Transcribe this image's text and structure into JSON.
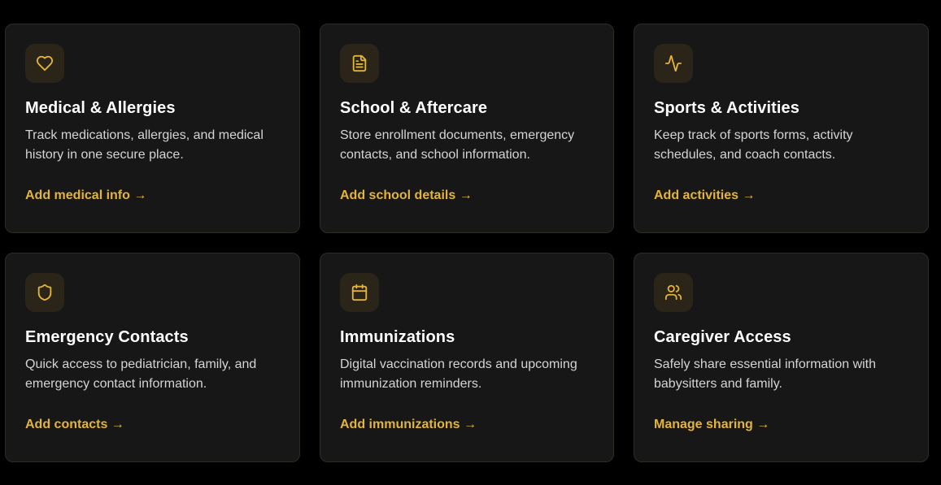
{
  "accent_color": "#e3b43a",
  "cards": [
    {
      "icon": "heart-icon",
      "title": "Medical & Allergies",
      "description": "Track medications, allergies, and medical history in one secure place.",
      "link": "Add medical info →"
    },
    {
      "icon": "document-icon",
      "title": "School & Aftercare",
      "description": "Store enrollment documents, emergency contacts, and school information.",
      "link": "Add school details →"
    },
    {
      "icon": "activity-icon",
      "title": "Sports & Activities",
      "description": "Keep track of sports forms, activity schedules, and coach contacts.",
      "link": "Add activities →"
    },
    {
      "icon": "shield-icon",
      "title": "Emergency Contacts",
      "description": "Quick access to pediatrician, family, and emergency contact information.",
      "link": "Add contacts →"
    },
    {
      "icon": "calendar-icon",
      "title": "Immunizations",
      "description": "Digital vaccination records and upcoming immunization reminders.",
      "link": "Add immunizations →"
    },
    {
      "icon": "users-icon",
      "title": "Caregiver Access",
      "description": "Safely share essential information with babysitters and family.",
      "link": "Manage sharing →"
    }
  ]
}
